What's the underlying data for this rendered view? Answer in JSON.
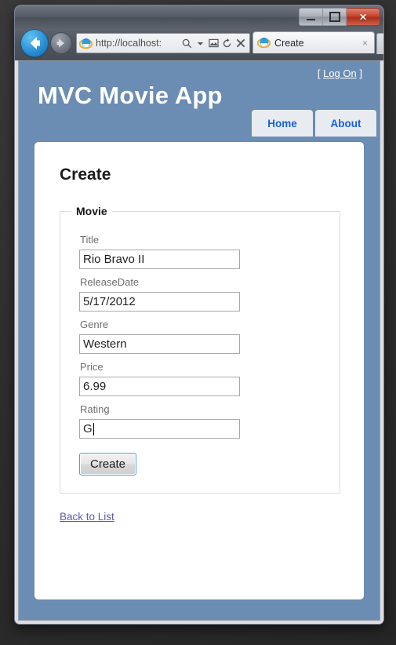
{
  "browser": {
    "window_buttons": [
      {
        "name": "minimize",
        "label": "–"
      },
      {
        "name": "maximize",
        "label": "❐"
      },
      {
        "name": "close",
        "label": "✕"
      }
    ],
    "back_tooltip": "Back",
    "forward_tooltip": "Forward",
    "address": {
      "url_text": "http://localhost:",
      "icons": [
        "search-icon",
        "dropdown-caret-icon",
        "compatibility-view-icon",
        "refresh-icon",
        "stop-icon"
      ]
    },
    "tab": {
      "title": "Create",
      "close_label": "×"
    }
  },
  "page": {
    "logon": {
      "open_bracket": "[",
      "link": "Log On",
      "close_bracket": "]"
    },
    "site_title": "MVC Movie App",
    "menu": [
      {
        "label": "Home"
      },
      {
        "label": "About"
      }
    ],
    "heading": "Create",
    "fieldset_legend": "Movie",
    "fields": [
      {
        "label": "Title",
        "value": "Rio Bravo II",
        "focused": false
      },
      {
        "label": "ReleaseDate",
        "value": "5/17/2012",
        "focused": false
      },
      {
        "label": "Genre",
        "value": "Western",
        "focused": false
      },
      {
        "label": "Price",
        "value": "6.99",
        "focused": false
      },
      {
        "label": "Rating",
        "value": "G",
        "focused": true
      }
    ],
    "submit_label": "Create",
    "back_link": "Back to List"
  },
  "colors": {
    "page_background": "#6b8cb3",
    "content_card": "#ffffff",
    "menu_item_bg": "#e8ecf0",
    "menu_item_text": "#1560e0",
    "link": "#5a5ab0",
    "button_focus_border": "#4e9fd4",
    "close_button": "#c9452f"
  }
}
